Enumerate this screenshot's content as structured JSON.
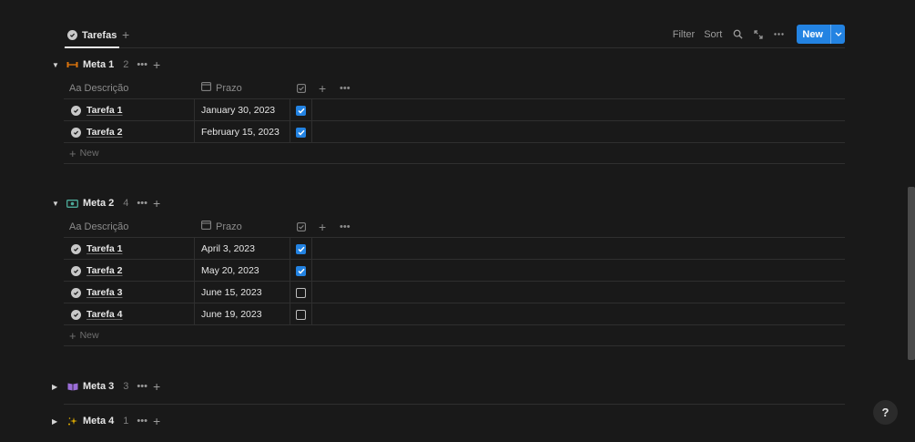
{
  "view_tab": {
    "label": "Tarefas",
    "icon": "check-circle-icon"
  },
  "toolbar": {
    "filter_label": "Filter",
    "sort_label": "Sort",
    "new_label": "New",
    "accent": "#2383e2"
  },
  "columns": {
    "descricao": "Aa Descrição",
    "prazo": "Prazo"
  },
  "new_row_label": "New",
  "groups": [
    {
      "name": "Meta 1",
      "count": "2",
      "icon": "dumbbell-icon",
      "icon_color": "#d9730d",
      "expanded": true,
      "rows": [
        {
          "name": "Tarefa 1",
          "date": "January 30, 2023",
          "done": true
        },
        {
          "name": "Tarefa 2",
          "date": "February 15, 2023",
          "done": true
        }
      ]
    },
    {
      "name": "Meta 2",
      "count": "4",
      "icon": "money-icon",
      "icon_color": "#4dab9a",
      "expanded": true,
      "rows": [
        {
          "name": "Tarefa 1",
          "date": "April 3, 2023",
          "done": true
        },
        {
          "name": "Tarefa 2",
          "date": "May 20, 2023",
          "done": true
        },
        {
          "name": "Tarefa 3",
          "date": "June 15, 2023",
          "done": false
        },
        {
          "name": "Tarefa 4",
          "date": "June 19, 2023",
          "done": false
        }
      ]
    },
    {
      "name": "Meta 3",
      "count": "3",
      "icon": "book-icon",
      "icon_color": "#9a6dd7",
      "expanded": false
    },
    {
      "name": "Meta 4",
      "count": "1",
      "icon": "sparkles-icon",
      "icon_color": "#dfab01",
      "expanded": false
    }
  ],
  "help_label": "?"
}
